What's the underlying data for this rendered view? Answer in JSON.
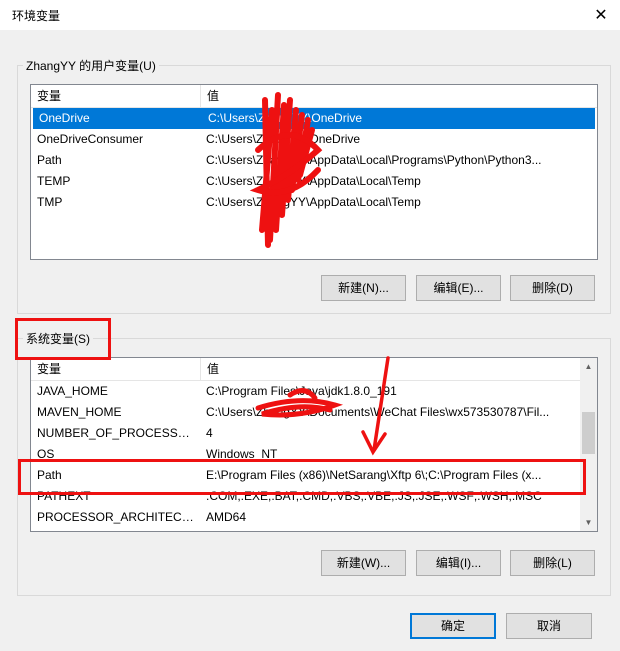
{
  "window": {
    "title": "环境变量",
    "close_glyph": "✕"
  },
  "user_vars": {
    "title": "ZhangYY 的用户变量(U)",
    "col_name": "变量",
    "col_value": "值",
    "rows": [
      {
        "name": "OneDrive",
        "value": "C:\\Users\\ZhangYY\\OneDrive",
        "selected": true
      },
      {
        "name": "OneDriveConsumer",
        "value": "C:\\Users\\ZhangYY\\OneDrive"
      },
      {
        "name": "Path",
        "value": "C:\\Users\\ZhangYY\\AppData\\Local\\Programs\\Python\\Python3..."
      },
      {
        "name": "TEMP",
        "value": "C:\\Users\\ZhangYY\\AppData\\Local\\Temp"
      },
      {
        "name": "TMP",
        "value": "C:\\Users\\ZhangYY\\AppData\\Local\\Temp"
      }
    ],
    "new_label": "新建(N)...",
    "edit_label": "编辑(E)...",
    "delete_label": "删除(D)"
  },
  "system_vars": {
    "title": "系统变量(S)",
    "col_name": "变量",
    "col_value": "值",
    "rows": [
      {
        "name": "JAVA_HOME",
        "value": "C:\\Program Files\\Java\\jdk1.8.0_191"
      },
      {
        "name": "MAVEN_HOME",
        "value": "C:\\Users\\ZhangYY\\Documents\\WeChat Files\\wx573530787\\Fil..."
      },
      {
        "name": "NUMBER_OF_PROCESSORS",
        "value": "4"
      },
      {
        "name": "OS",
        "value": "Windows_NT"
      },
      {
        "name": "Path",
        "value": "E:\\Program Files (x86)\\NetSarang\\Xftp 6\\;C:\\Program Files (x..."
      },
      {
        "name": "PATHEXT",
        "value": ".COM;.EXE;.BAT;.CMD;.VBS;.VBE;.JS;.JSE;.WSF;.WSH;.MSC"
      },
      {
        "name": "PROCESSOR_ARCHITECT...",
        "value": "AMD64"
      }
    ],
    "new_label": "新建(W)...",
    "edit_label": "编辑(I)...",
    "delete_label": "删除(L)"
  },
  "footer": {
    "ok_label": "确定",
    "cancel_label": "取消"
  },
  "colors": {
    "selection": "#0078d7",
    "annotation": "#ee1111"
  },
  "icons": {
    "scroll_up": "▲",
    "scroll_down": "▼"
  }
}
